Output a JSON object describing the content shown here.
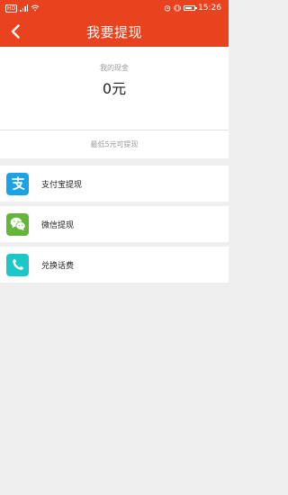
{
  "status": {
    "time": "15:26",
    "badge": "HD"
  },
  "header": {
    "title": "我要提现",
    "bg_color": "#e8431e"
  },
  "cash": {
    "label": "我的现金",
    "value": "0元"
  },
  "note": "最低5元可提现",
  "options": [
    {
      "label": "支付宝提现",
      "icon": "alipay-icon",
      "color": "#1aa3e8"
    },
    {
      "label": "微信提现",
      "icon": "wechat-icon",
      "color": "#63b63a"
    },
    {
      "label": "兑换话费",
      "icon": "phone-icon",
      "color": "#1cc7c7"
    }
  ]
}
